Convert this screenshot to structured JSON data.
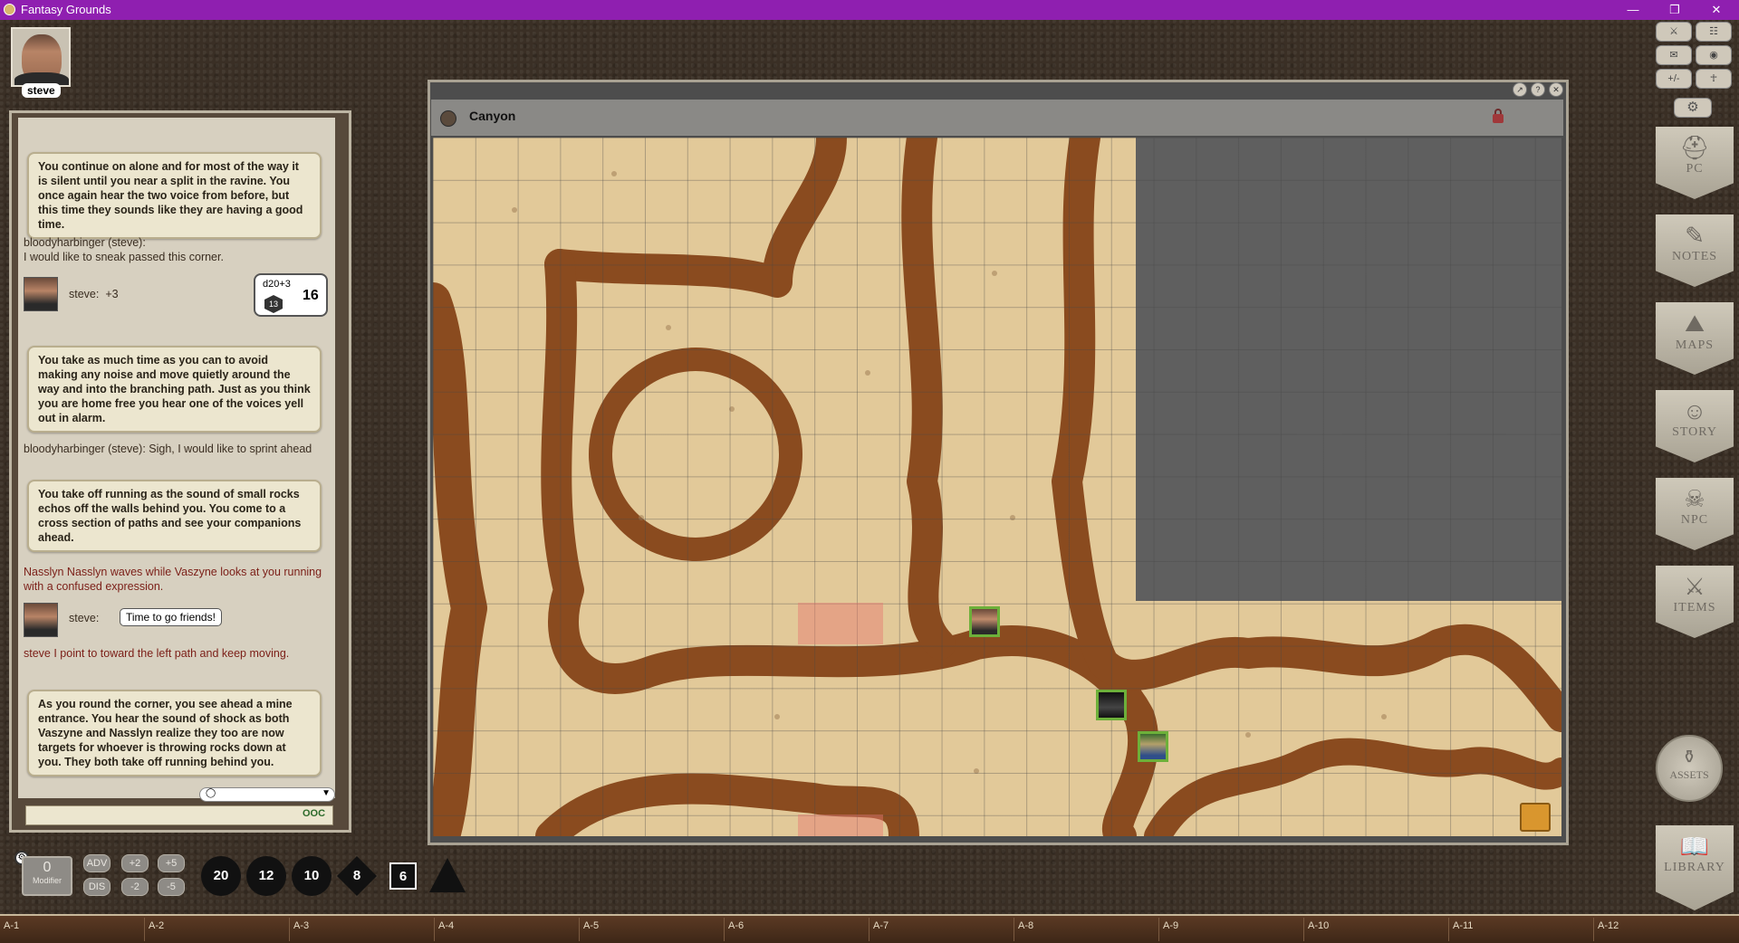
{
  "window": {
    "title": "Fantasy Grounds",
    "controls": [
      "—",
      "❐",
      "✕"
    ]
  },
  "player": {
    "name": "steve"
  },
  "chat": {
    "messages": [
      {
        "kind": "story",
        "text": "You continue on alone and for most of the way it is silent until you near a split in the ravine. You once again hear the two voice from before, but this time they sounds like they are having a good time."
      },
      {
        "kind": "line",
        "text": "bloodyharbinger (steve):"
      },
      {
        "kind": "line",
        "text": "I would like to sneak passed this corner."
      },
      {
        "kind": "roll",
        "speaker": "steve:",
        "modifier": "+3",
        "expr": "d20+3",
        "die_face": "13",
        "total": "16"
      },
      {
        "kind": "story",
        "text": "You take as much time as you can to avoid making any noise and move quietly around the way and into the branching path. Just as you think you are home free you hear one of the voices yell out in alarm."
      },
      {
        "kind": "line",
        "text": "bloodyharbinger (steve):    Sigh, I would like to sprint ahead"
      },
      {
        "kind": "story",
        "text": "You take off running as the sound of small rocks echos off the walls behind you. You come to a cross section of paths and see your companions ahead."
      },
      {
        "kind": "emote",
        "text": "Nasslyn Nasslyn waves while Vaszyne looks at you running with a confused expression."
      },
      {
        "kind": "speech",
        "speaker": "steve:",
        "text": "Time to go friends!"
      },
      {
        "kind": "emote",
        "text": "steve I point to toward the left path and keep moving."
      },
      {
        "kind": "story",
        "text": "As you round the corner, you see ahead a mine entrance. You hear the sound of shock as both Vaszyne and Nasslyn realize they too are now targets for whoever is throwing rocks down at you. They both take off running behind you."
      }
    ],
    "mode_icon": "speech-bubble-icon",
    "ooc_label": "OOC"
  },
  "map": {
    "title": "Canyon",
    "lock_icon": "lock-icon"
  },
  "sidebar": {
    "tabs": [
      {
        "label": "PC",
        "icon": "helmet-icon",
        "glyph": "⛑"
      },
      {
        "label": "NOTES",
        "icon": "quill-icon",
        "glyph": "✎"
      },
      {
        "label": "MAPS",
        "icon": "map-icon",
        "glyph": "⛰"
      },
      {
        "label": "STORY",
        "icon": "masks-icon",
        "glyph": "☺"
      },
      {
        "label": "NPC",
        "icon": "skull-icon",
        "glyph": "☠"
      },
      {
        "label": "ITEMS",
        "icon": "swords-icon",
        "glyph": "⚔"
      }
    ],
    "assets_label": "ASSETS",
    "library_label": "LIBRARY",
    "top_buttons": [
      "⚔",
      "☷",
      "✉",
      "◉",
      "+/-",
      "☥"
    ],
    "settings_glyph": "⚙"
  },
  "dice_tray": {
    "modifier_value": "0",
    "modifier_label": "Modifier",
    "buttons": [
      "ADV",
      "+2",
      "+5",
      "DIS",
      "-2",
      "-5"
    ],
    "dice": [
      "20",
      "12",
      "10",
      "8",
      "6",
      ""
    ]
  },
  "hotbar": [
    "A-1",
    "A-2",
    "A-3",
    "A-4",
    "A-5",
    "A-6",
    "A-7",
    "A-8",
    "A-9",
    "A-10",
    "A-11",
    "A-12"
  ]
}
